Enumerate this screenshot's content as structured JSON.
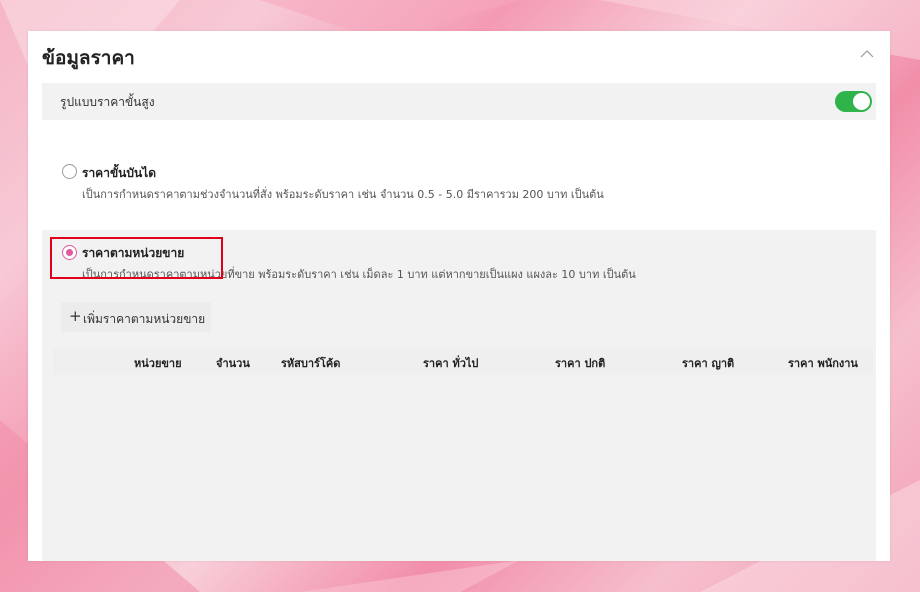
{
  "section": {
    "title": "ข้อมูลราคา",
    "collapse_icon": "chevron-up-icon"
  },
  "advanced": {
    "label": "รูปแบบราคาขั้นสูง",
    "enabled": true,
    "toggle_color": "#2fb34a"
  },
  "options": [
    {
      "title": "ราคาขั้นบันได",
      "description": "เป็นการกำหนดราคาตามช่วงจำนวนที่สั่ง พร้อมระดับราคา เช่น จำนวน 0.5 - 5.0 มีราคารวม 200 บาท เป็นต้น",
      "selected": false
    },
    {
      "title": "ราคาตามหน่วยขาย",
      "description": "เป็นการกำหนดราคาตามหน่วยที่ขาย พร้อมระดับราคา เช่น เม็ดละ 1 บาท แต่หากขายเป็นแผง แผงละ 10 บาท เป็นต้น",
      "selected": true
    }
  ],
  "add_button": {
    "icon": "plus-icon",
    "label": "เพิ่มราคาตามหน่วยขาย"
  },
  "table": {
    "columns": [
      "หน่วยขาย",
      "จำนวน",
      "รหัสบาร์โค้ด",
      "ราคา ทั่วไป",
      "ราคา ปกติ",
      "ราคา ญาติ",
      "ราคา พนักงาน"
    ]
  },
  "colors": {
    "accent_radio": "#e05a9e",
    "highlight_border": "#e0001b"
  }
}
